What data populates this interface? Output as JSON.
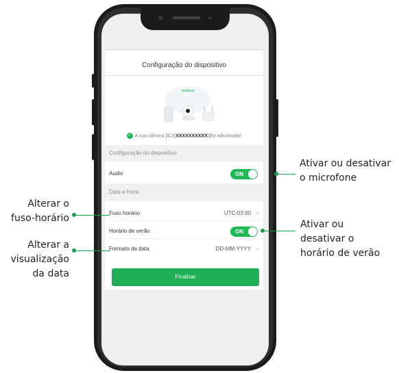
{
  "screen": {
    "title": "Configuração do dispositivo",
    "brand_logo_text": "intelbras",
    "success_message": {
      "prefix": "A sua câmera [iC3(",
      "serial": "XXXXXXXXXX",
      "suffix": ")]foi adicionada!"
    },
    "device_section": {
      "header": "Configuração do dispositivo",
      "audio": {
        "label": "Audio",
        "toggle": "ON"
      }
    },
    "datetime_section": {
      "header": "Data e Hora",
      "timezone": {
        "label": "Fuso horário",
        "value": "UTC-03:00"
      },
      "dst": {
        "label": "Horário de verão",
        "toggle": "ON"
      },
      "date_format": {
        "label": "Formato da data",
        "value": "DD-MM-YYYY"
      }
    },
    "finish_button": "Finalizar"
  },
  "annotations": {
    "audio": [
      "Ativar ou desativar",
      "o microfone"
    ],
    "dst": [
      "Ativar ou",
      "desativar o",
      "horário de verão"
    ],
    "timezone": [
      "Alterar o",
      "fuso-horário"
    ],
    "date_format": [
      "Alterar a",
      "visualização",
      "da data"
    ]
  },
  "colors": {
    "accent": "#1db954",
    "annotation_line": "#1a9e4c"
  },
  "icons": [
    "check-icon",
    "chevron-right-icon",
    "camera-icon",
    "router-icon",
    "phone-icon"
  ]
}
